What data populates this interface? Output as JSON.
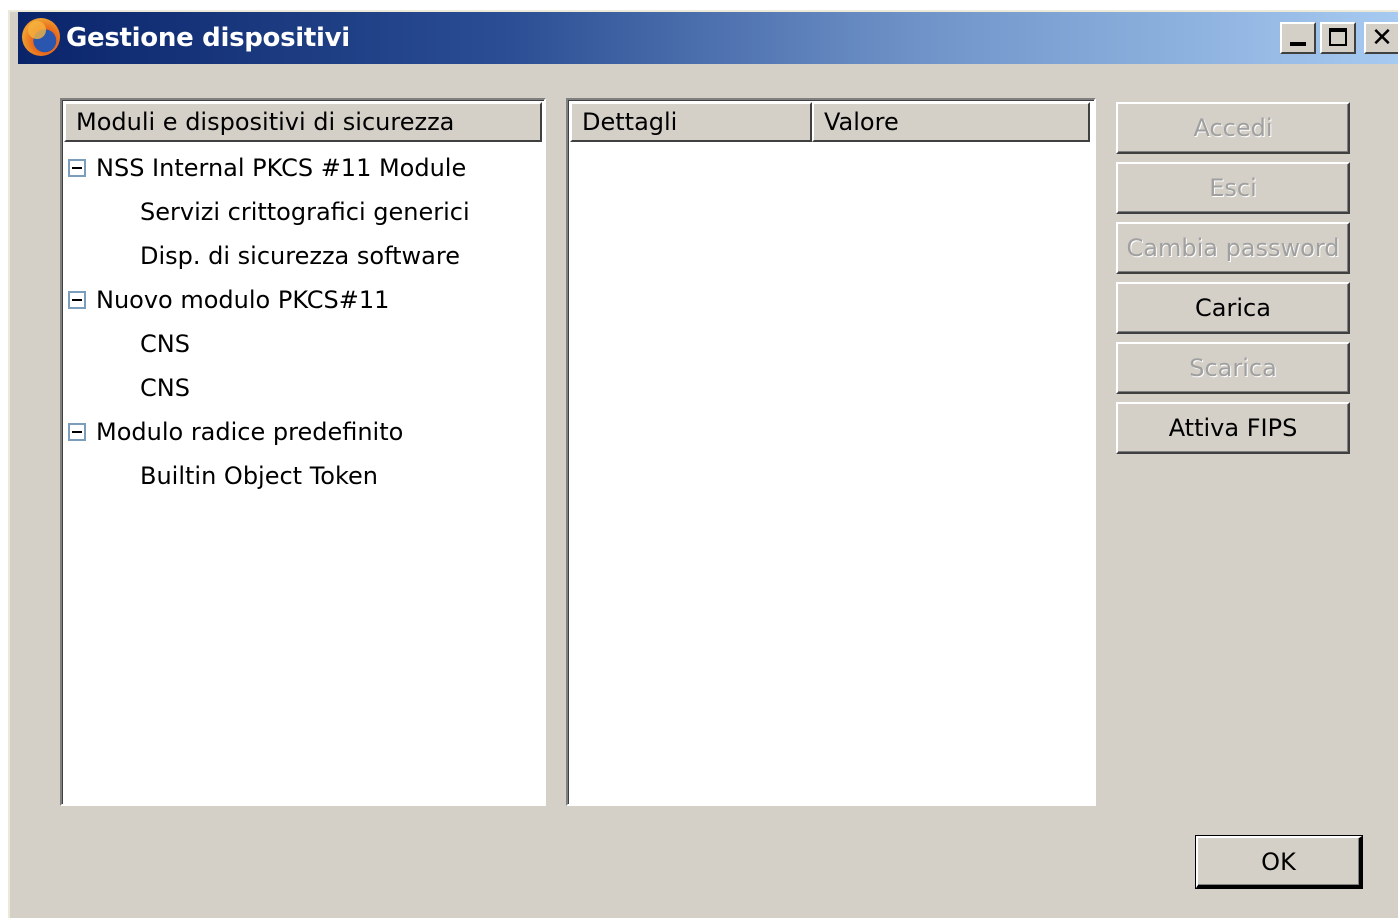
{
  "window": {
    "title": "Gestione dispositivi",
    "controls": {
      "close_glyph": "✕"
    }
  },
  "modules_panel": {
    "header": "Moduli e dispositivi di sicurezza",
    "tree": [
      {
        "label": "NSS Internal PKCS #11 Module",
        "level": 0,
        "expanded": true
      },
      {
        "label": "Servizi crittografici generici",
        "level": 1
      },
      {
        "label": "Disp. di sicurezza software",
        "level": 1
      },
      {
        "label": "Nuovo modulo PKCS#11",
        "level": 0,
        "expanded": true
      },
      {
        "label": "CNS",
        "level": 1
      },
      {
        "label": "CNS",
        "level": 1
      },
      {
        "label": "Modulo radice predefinito",
        "level": 0,
        "expanded": true
      },
      {
        "label": "Builtin Object Token",
        "level": 1
      }
    ]
  },
  "details_panel": {
    "columns": [
      "Dettagli",
      "Valore"
    ]
  },
  "actions": {
    "accedi": "Accedi",
    "esci": "Esci",
    "cambia_password": "Cambia password",
    "carica": "Carica",
    "scarica": "Scarica",
    "attiva_fips": "Attiva FIPS"
  },
  "ok_button": "OK",
  "colors": {
    "titlebar_start": "#0a246a",
    "titlebar_end": "#a6caf0",
    "dialog_face": "#d4d0c8",
    "disabled_text": "#a0a0a0"
  },
  "icons": {
    "app": "firefox-icon",
    "tree_toggle": "collapse-minus-icon"
  }
}
